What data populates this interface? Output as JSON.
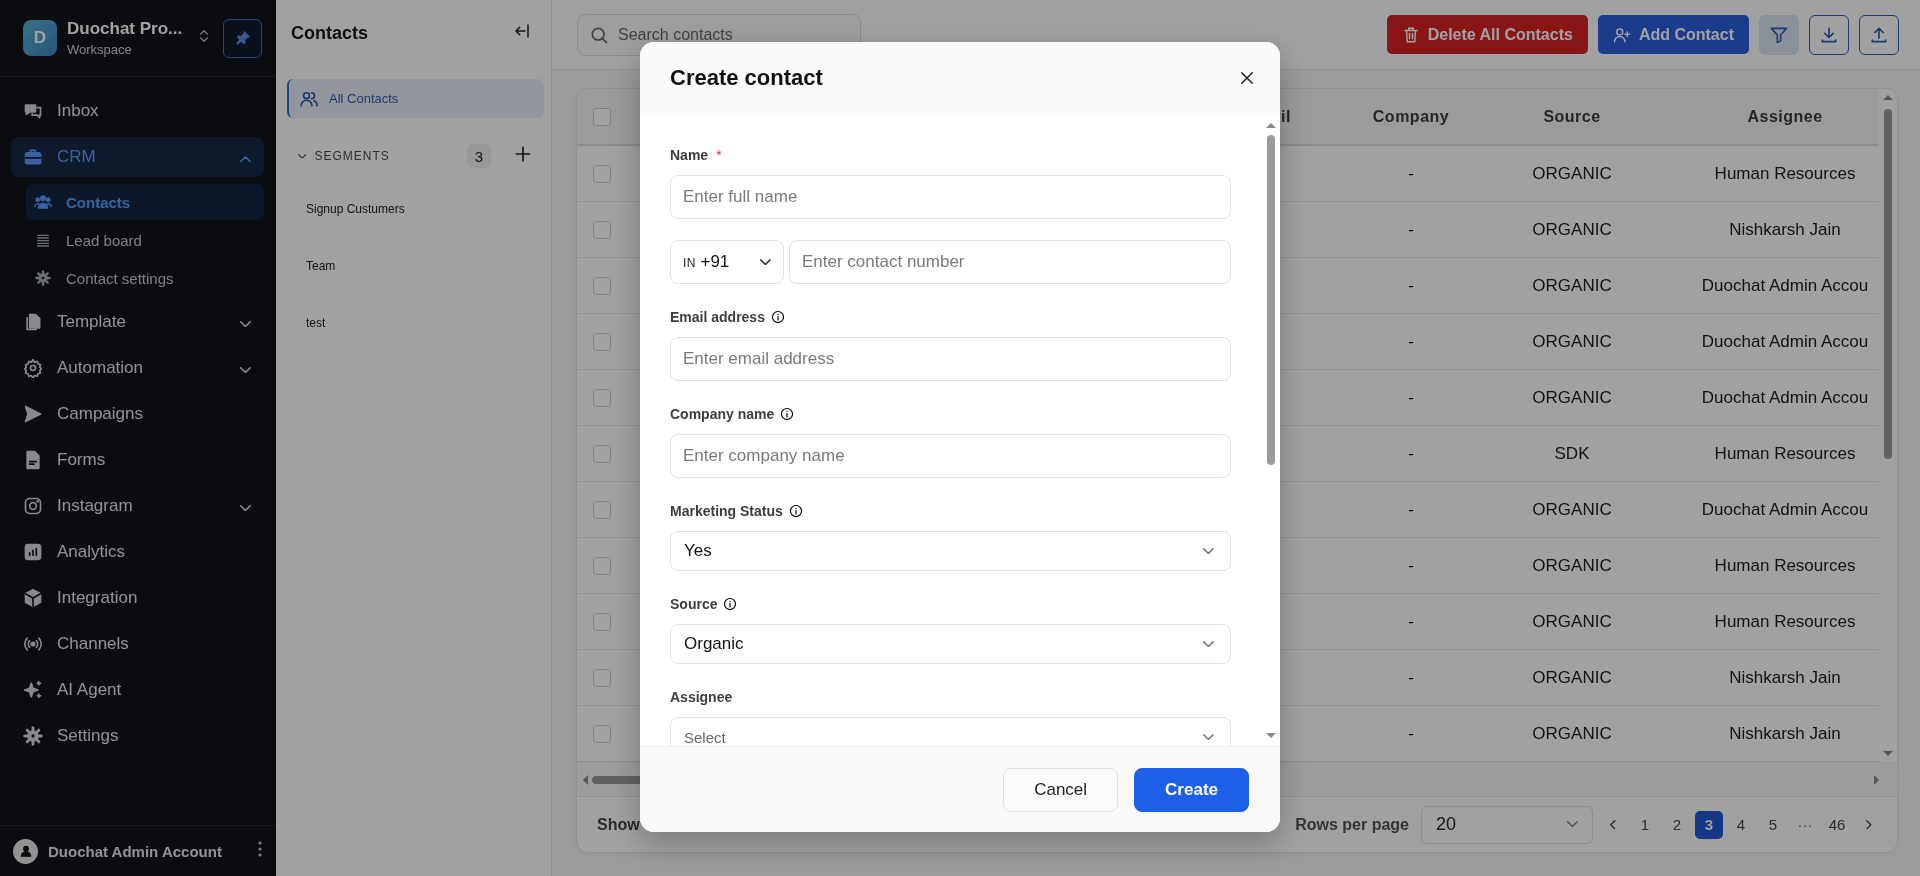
{
  "sidebar": {
    "workspace": {
      "initial": "D",
      "name": "Duochat Pro...",
      "subtitle": "Workspace"
    },
    "items": [
      {
        "label": "Inbox",
        "selected": false
      },
      {
        "label": "CRM",
        "selected": true,
        "expanded": true,
        "children": [
          {
            "label": "Contacts",
            "selected": true
          },
          {
            "label": "Lead board",
            "selected": false
          },
          {
            "label": "Contact settings",
            "selected": false
          }
        ]
      },
      {
        "label": "Template",
        "selected": false,
        "expanded": false
      },
      {
        "label": "Automation",
        "selected": false,
        "expanded": false
      },
      {
        "label": "Campaigns",
        "selected": false
      },
      {
        "label": "Forms",
        "selected": false
      },
      {
        "label": "Instagram",
        "selected": false,
        "expanded": false
      },
      {
        "label": "Analytics",
        "selected": false
      },
      {
        "label": "Integration",
        "selected": false
      },
      {
        "label": "Channels",
        "selected": false
      },
      {
        "label": "AI Agent",
        "selected": false
      },
      {
        "label": "Settings",
        "selected": false
      }
    ],
    "account": {
      "name": "Duochat Admin Account"
    }
  },
  "contacts_panel": {
    "title": "Contacts",
    "all_contacts": {
      "label": "All Contacts",
      "selected": true
    },
    "segments": {
      "label": "SEGMENTS",
      "count": "3",
      "expanded": true,
      "items": [
        {
          "label": "Signup Custumers",
          "selected": false
        },
        {
          "label": "Team",
          "selected": false
        },
        {
          "label": "test",
          "selected": false
        }
      ]
    }
  },
  "toolbar": {
    "search": {
      "placeholder": "Search contacts"
    },
    "buttons": [
      {
        "label": "Delete All Contacts",
        "kind": "danger"
      },
      {
        "label": "Add Contact",
        "kind": "primary"
      }
    ],
    "icon_buttons": [
      {
        "selected": true
      },
      {
        "selected": false
      },
      {
        "selected": false
      }
    ]
  },
  "table": {
    "header": {
      "checked": false,
      "column_2": "il",
      "company": "Company",
      "source": "Source",
      "assignee": "Assignee"
    },
    "rows": [
      {
        "checked": false,
        "company": "-",
        "source": "ORGANIC",
        "assignee": "Human Resources"
      },
      {
        "checked": false,
        "company": "-",
        "source": "ORGANIC",
        "assignee": "Nishkarsh Jain"
      },
      {
        "checked": false,
        "company": "-",
        "source": "ORGANIC",
        "assignee": "Duochat Admin Accou"
      },
      {
        "checked": false,
        "company": "-",
        "source": "ORGANIC",
        "assignee": "Duochat Admin Accou"
      },
      {
        "checked": false,
        "company": "-",
        "source": "ORGANIC",
        "assignee": "Duochat Admin Accou"
      },
      {
        "checked": false,
        "company": "-",
        "source": "SDK",
        "assignee": "Human Resources"
      },
      {
        "checked": false,
        "company": "-",
        "source": "ORGANIC",
        "assignee": "Duochat Admin Accou"
      },
      {
        "checked": false,
        "company": "-",
        "source": "ORGANIC",
        "assignee": "Human Resources"
      },
      {
        "checked": false,
        "company": "-",
        "source": "ORGANIC",
        "assignee": "Human Resources"
      },
      {
        "checked": false,
        "company": "-",
        "source": "ORGANIC",
        "assignee": "Nishkarsh Jain"
      },
      {
        "checked": false,
        "company": "-",
        "source": "ORGANIC",
        "assignee": "Nishkarsh Jain"
      }
    ],
    "footer": {
      "showing": "Show",
      "rows_per_page_label": "Rows per page",
      "rows_per_page": "20",
      "pages": [
        {
          "label": "1",
          "kind": "page",
          "selected": false
        },
        {
          "label": "2",
          "kind": "page",
          "selected": false
        },
        {
          "label": "3",
          "kind": "page",
          "selected": true
        },
        {
          "label": "4",
          "kind": "page",
          "selected": false
        },
        {
          "label": "5",
          "kind": "page",
          "selected": false
        },
        {
          "label": "···",
          "kind": "ellipsis",
          "selected": false
        },
        {
          "label": "46",
          "kind": "page",
          "selected": false
        }
      ]
    }
  },
  "modal": {
    "title": "Create contact",
    "required_mark": "*",
    "fields": [
      {
        "kind": "text",
        "label": "Name",
        "required": true,
        "info": false,
        "placeholder": "Enter full name"
      },
      {
        "kind": "phone",
        "country_flag": "IN",
        "country_code": "+91",
        "placeholder": "Enter contact number"
      },
      {
        "kind": "text",
        "label": "Email address",
        "required": false,
        "info": true,
        "placeholder": "Enter email address"
      },
      {
        "kind": "text",
        "label": "Company name",
        "required": false,
        "info": true,
        "placeholder": "Enter company name"
      },
      {
        "kind": "select",
        "label": "Marketing Status",
        "required": false,
        "info": true,
        "value": "Yes"
      },
      {
        "kind": "select",
        "label": "Source",
        "required": false,
        "info": true,
        "value": "Organic"
      },
      {
        "kind": "select",
        "label": "Assignee",
        "required": false,
        "info": false,
        "placeholder": "Select"
      }
    ],
    "buttons": [
      {
        "label": "Cancel",
        "kind": "secondary"
      },
      {
        "label": "Create",
        "kind": "primary"
      }
    ]
  }
}
